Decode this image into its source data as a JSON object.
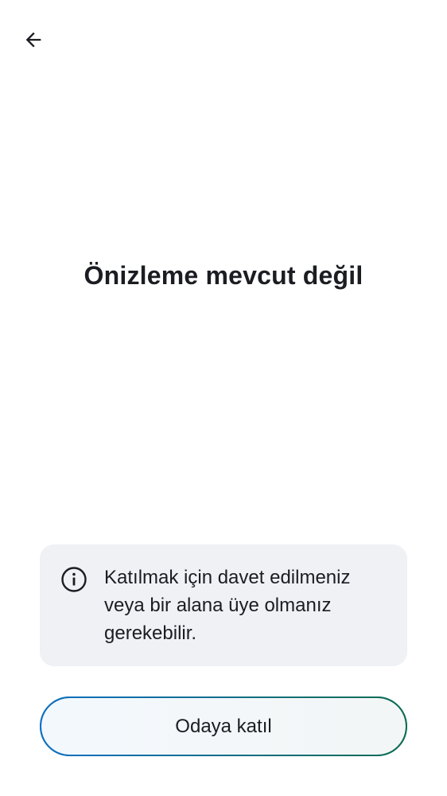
{
  "header": {
    "back_icon": "arrow-left-icon"
  },
  "main": {
    "title": "Önizleme mevcut değil"
  },
  "notice": {
    "icon": "info-icon",
    "text": "Katılmak için davet edilmeniz veya bir alana üye olmanız gerekebilir."
  },
  "actions": {
    "join_label": "Odaya katıl"
  },
  "colors": {
    "background": "#ffffff",
    "text": "#1b1d22",
    "notice_background": "#f0f1f5",
    "button_border_start": "#0b6fc6",
    "button_border_end": "#0b6d4e"
  }
}
